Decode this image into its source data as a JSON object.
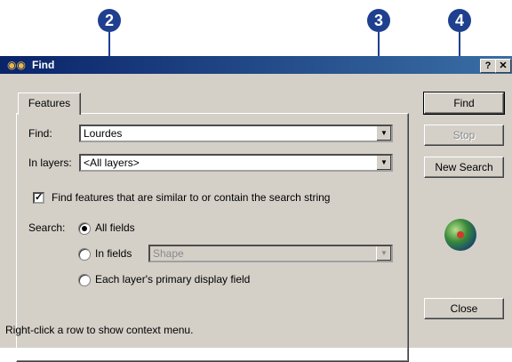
{
  "callouts": [
    "2",
    "3",
    "4"
  ],
  "window": {
    "title": "Find",
    "help_label": "?",
    "close_label": "✕"
  },
  "tab": {
    "label": "Features"
  },
  "find": {
    "label": "Find:",
    "value": "Lourdes"
  },
  "layers": {
    "label": "In layers:",
    "value": "<All layers>"
  },
  "similar_checkbox": {
    "checked": true,
    "label": "Find features that are similar to or contain the search string"
  },
  "search": {
    "label": "Search:",
    "options": [
      {
        "label": "All fields",
        "selected": true
      },
      {
        "label": "In fields",
        "selected": false
      },
      {
        "label": "Each layer's primary display field",
        "selected": false
      }
    ],
    "in_fields_value": "Shape"
  },
  "buttons": {
    "find": "Find",
    "stop": "Stop",
    "new_search": "New Search",
    "close": "Close"
  },
  "status_text": "Right-click a row to show context menu.",
  "icons": {
    "title_icon": "binoculars-icon",
    "dropdown": "chevron-down-icon",
    "globe": "globe-icon"
  },
  "colors": {
    "callout": "#1f3f8f",
    "titlebar_start": "#0a246a",
    "titlebar_end": "#3a6ea5",
    "dialog_face": "#d4d0c8"
  }
}
